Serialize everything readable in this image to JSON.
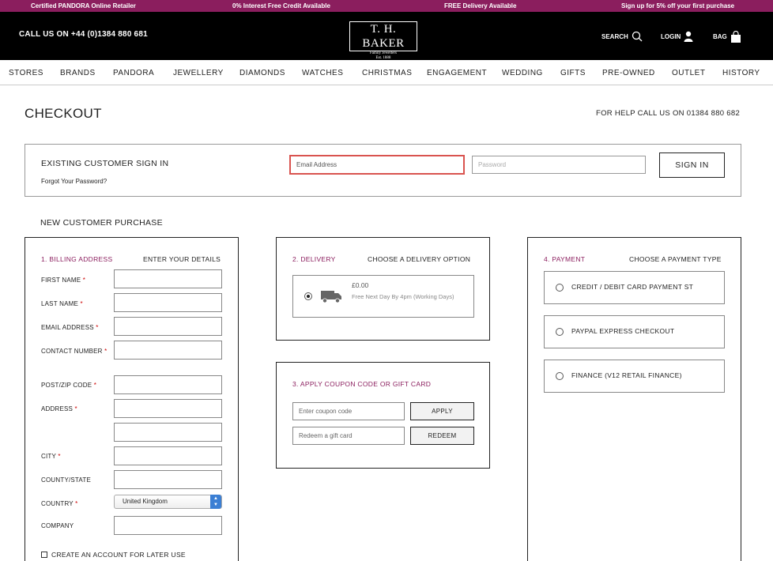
{
  "promo": [
    "Certified PANDORA Online Retailer",
    "0% Interest Free Credit Available",
    "FREE Delivery Available",
    "Sign up for 5% off your first purchase"
  ],
  "header": {
    "call": "CALL US ON +44 (0)1384 880 681",
    "logo_name": "T. H. BAKER",
    "logo_sub1": "Family Jewellers",
    "logo_sub2": "Est. 1888",
    "search": "SEARCH",
    "login": "LOGIN",
    "bag": "BAG"
  },
  "nav": [
    "STORES",
    "BRANDS",
    "PANDORA",
    "JEWELLERY",
    "DIAMONDS",
    "WATCHES",
    "CHRISTMAS",
    "ENGAGEMENT",
    "WEDDING",
    "GIFTS",
    "PRE-OWNED",
    "OUTLET",
    "HISTORY"
  ],
  "page": {
    "title": "CHECKOUT",
    "help": "FOR HELP CALL US ON 01384 880 682"
  },
  "signin": {
    "title": "EXISTING CUSTOMER SIGN IN",
    "forgot": "Forgot Your Password?",
    "email_placeholder": "Email Address",
    "password_placeholder": "Password",
    "button": "SIGN IN"
  },
  "new_customer": "NEW CUSTOMER PURCHASE",
  "billing": {
    "step": "1. BILLING ADDRESS",
    "hint": "ENTER YOUR DETAILS",
    "fields": [
      "FIRST NAME",
      "LAST NAME",
      "EMAIL ADDRESS",
      "CONTACT NUMBER",
      "POST/ZIP CODE",
      "ADDRESS",
      "CITY",
      "COUNTY/STATE",
      "COUNTRY",
      "COMPANY"
    ],
    "required_mark": "*",
    "country_value": "United Kingdom",
    "create_account": "CREATE AN ACCOUNT FOR LATER USE"
  },
  "delivery": {
    "step": "2. DELIVERY",
    "hint": "CHOOSE A DELIVERY OPTION",
    "price": "£0.00",
    "note": "Free Next Day By 4pm (Working Days)"
  },
  "coupon": {
    "step": "3. APPLY COUPON CODE OR GIFT CARD",
    "coupon_placeholder": "Enter coupon code",
    "apply": "APPLY",
    "gift_placeholder": "Redeem a gift card",
    "redeem": "REDEEM"
  },
  "payment": {
    "step": "4. PAYMENT",
    "hint": "CHOOSE A PAYMENT TYPE",
    "options": [
      "CREDIT / DEBIT CARD PAYMENT ST",
      "PAYPAL EXPRESS CHECKOUT",
      "FINANCE (V12 RETAIL FINANCE)"
    ]
  },
  "colors": {
    "accent": "#8b1e5e",
    "header_bg": "#000000",
    "error": "#d9534f"
  }
}
